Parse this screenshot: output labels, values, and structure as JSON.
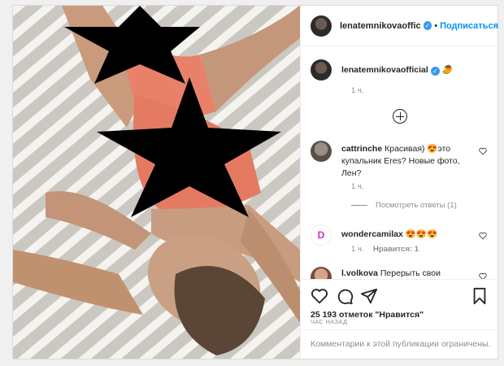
{
  "post": {
    "author": "lenatemnikovaofficial",
    "header_username": "lenatemnikovaoffic",
    "dot": "•",
    "follow_label": "Подписаться",
    "caption_emoji": "🥭",
    "caption_time": "1 ч.",
    "likes": "25 193 отметок \"Нравится\"",
    "posted_ago": "ЧАС НАЗАД",
    "comments_restricted": "Комментарии к этой публикации ограничены."
  },
  "comments": [
    {
      "user": "cattrinche",
      "text": "Красивая) 😍это купальник Eres? Новые фото, Лен?",
      "time": "1 ч.",
      "view_replies": "Посмотреть ответы (1)"
    },
    {
      "user": "wondercamilax",
      "text": "😍😍😍",
      "time": "1 ч.",
      "likes": "Нравится: 1"
    },
    {
      "user": "l.volkova",
      "text": "Перерыть свои"
    }
  ],
  "colors": {
    "accent": "#0095f6",
    "verified": "#3897f0",
    "muted": "#8e8e8e"
  },
  "icons": [
    "heart-icon",
    "comment-icon",
    "share-icon",
    "bookmark-icon",
    "verified-icon",
    "load-more-icon"
  ]
}
